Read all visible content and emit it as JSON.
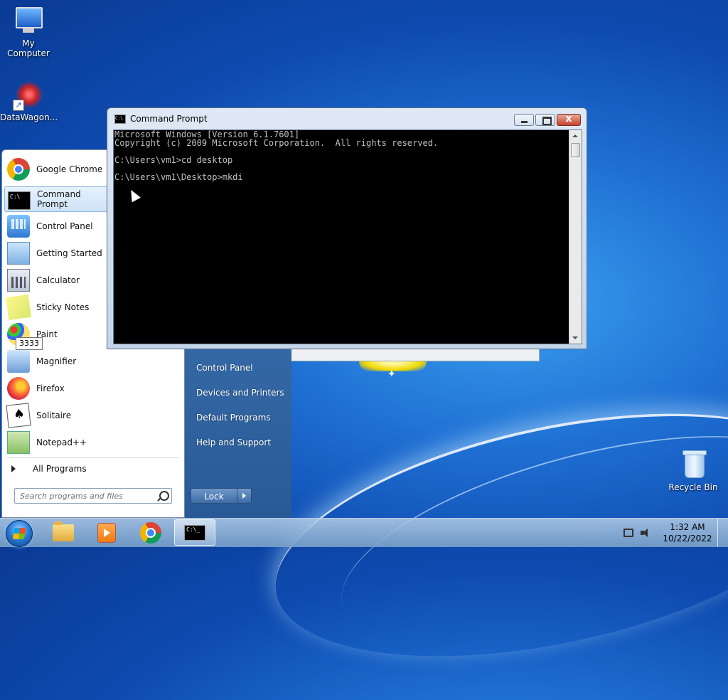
{
  "desktop": {
    "icons": [
      {
        "label": "My Computer"
      },
      {
        "label": "DataWagon..."
      },
      {
        "label": "Recycle Bin"
      }
    ]
  },
  "start_menu": {
    "programs": [
      {
        "label": "Google Chrome",
        "icon": "chrome-icon"
      },
      {
        "label": "Command Prompt",
        "icon": "command-prompt-icon"
      },
      {
        "label": "Control Panel",
        "icon": "control-panel-icon"
      },
      {
        "label": "Getting Started",
        "icon": "getting-started-icon"
      },
      {
        "label": "Calculator",
        "icon": "calculator-icon"
      },
      {
        "label": "Sticky Notes",
        "icon": "sticky-notes-icon"
      },
      {
        "label": "Paint",
        "icon": "paint-icon"
      },
      {
        "label": "Magnifier",
        "icon": "magnifier-icon"
      },
      {
        "label": "Firefox",
        "icon": "firefox-icon"
      },
      {
        "label": "Solitaire",
        "icon": "solitaire-icon"
      },
      {
        "label": "Notepad++",
        "icon": "notepad-plus-plus-icon"
      }
    ],
    "all_programs": "All Programs",
    "search_placeholder": "Search programs and files",
    "right_items": [
      "Control Panel",
      "Devices and Printers",
      "Default Programs",
      "Help and Support"
    ],
    "lock_label": "Lock",
    "tooltip": "3333"
  },
  "cmd_window": {
    "title": "Command Prompt",
    "lines": "Microsoft Windows [Version 6.1.7601]\nCopyright (c) 2009 Microsoft Corporation.  All rights reserved.\n\nC:\\Users\\vm1>cd desktop\n\nC:\\Users\\vm1\\Desktop>mkdi",
    "close_glyph": "x",
    "icon_text": "C:\\"
  },
  "taskbar": {
    "cmd_icon_text": "C:\\_",
    "time": "1:32 AM",
    "date": "10/22/2022"
  }
}
